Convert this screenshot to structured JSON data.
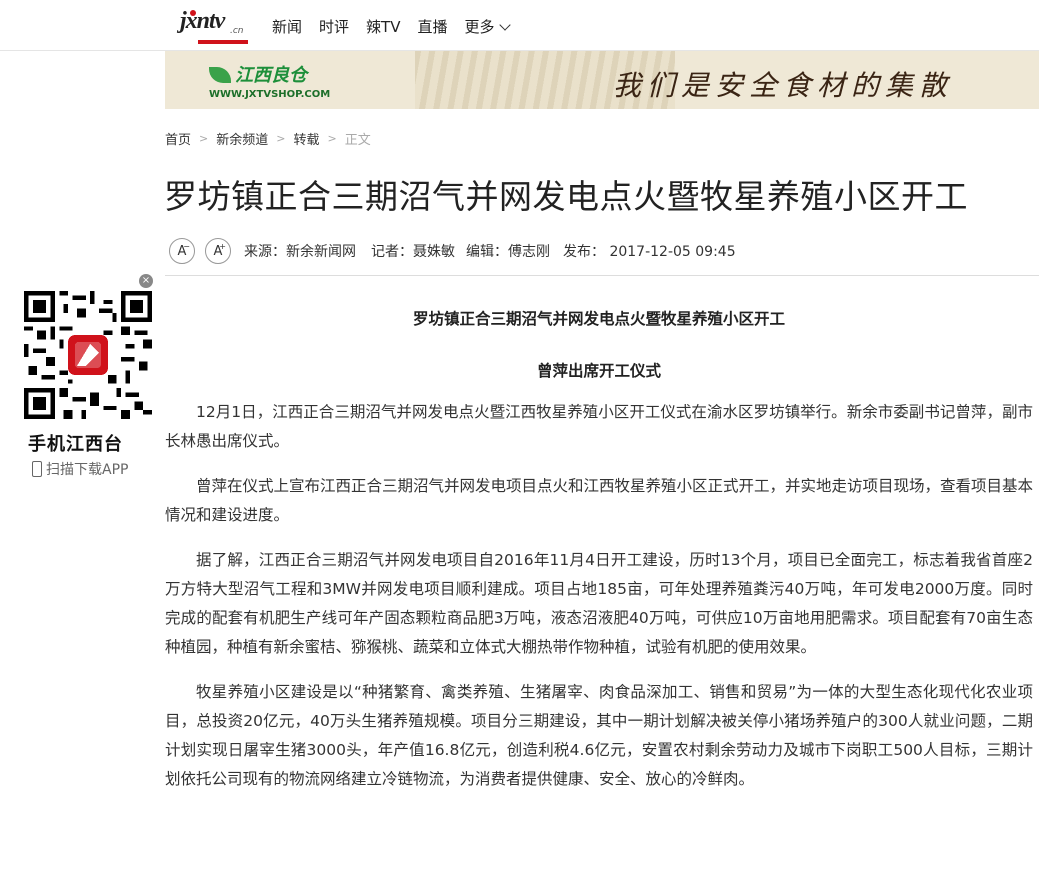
{
  "site": {
    "logo_text": "jxntv",
    "logo_suffix": ".cn"
  },
  "nav": {
    "items": [
      "新闻",
      "时评",
      "辣TV",
      "直播"
    ],
    "more_label": "更多"
  },
  "banner": {
    "brand": "江西良仓",
    "url": "WWW.JXTVSHOP.COM",
    "slogan": "我们是安全食材的集散"
  },
  "breadcrumb": {
    "items": [
      "首页",
      "新余频道",
      "转载"
    ],
    "current": "正文"
  },
  "article": {
    "title": "罗坊镇正合三期沼气并网发电点火暨牧星养殖小区开工",
    "meta": {
      "source": "来源：新余新闻网",
      "reporter": "记者：聂姝敏",
      "editor": "编辑：傅志刚",
      "published": "发布： 2017-12-05 09:45",
      "font_decrease": "A",
      "font_increase": "A"
    },
    "heading": "罗坊镇正合三期沼气并网发电点火暨牧星养殖小区开工",
    "subheading": "曾萍出席开工仪式",
    "paragraphs": [
      "12月1日，江西正合三期沼气并网发电点火暨江西牧星养殖小区开工仪式在渝水区罗坊镇举行。新余市委副书记曾萍，副市长林愚出席仪式。",
      "曾萍在仪式上宣布江西正合三期沼气并网发电项目点火和江西牧星养殖小区正式开工，并实地走访项目现场，查看项目基本情况和建设进度。",
      "据了解，江西正合三期沼气并网发电项目自2016年11月4日开工建设，历时13个月，项目已全面完工，标志着我省首座2万方特大型沼气工程和3MW并网发电项目顺利建成。项目占地185亩，可年处理养殖粪污40万吨，年可发电2000万度。同时完成的配套有机肥生产线可年产固态颗粒商品肥3万吨，液态沼液肥40万吨，可供应10万亩地用肥需求。项目配套有70亩生态种植园，种植有新余蜜桔、猕猴桃、蔬菜和立体式大棚热带作物种植，试验有机肥的使用效果。",
      "牧星养殖小区建设是以“种猪繁育、禽类养殖、生猪屠宰、肉食品深加工、销售和贸易”为一体的大型生态化现代化农业项目，总投资20亿元，40万头生猪养殖规模。项目分三期建设，其中一期计划解决被关停小猪场养殖户的300人就业问题，二期计划实现日屠宰生猪3000头，年产值16.8亿元，创造利税4.6亿元，安置农村剩余劳动力及城市下岗职工500人目标，三期计划依托公司现有的物流网络建立冷链物流，为消费者提供健康、安全、放心的冷鲜肉。"
    ]
  },
  "sidebar": {
    "qr_title": "手机江西台",
    "qr_subtitle": "扫描下载APP",
    "close_label": "×"
  },
  "colors": {
    "brand_red": "#d0121b",
    "banner_green": "#1d8f3a"
  }
}
